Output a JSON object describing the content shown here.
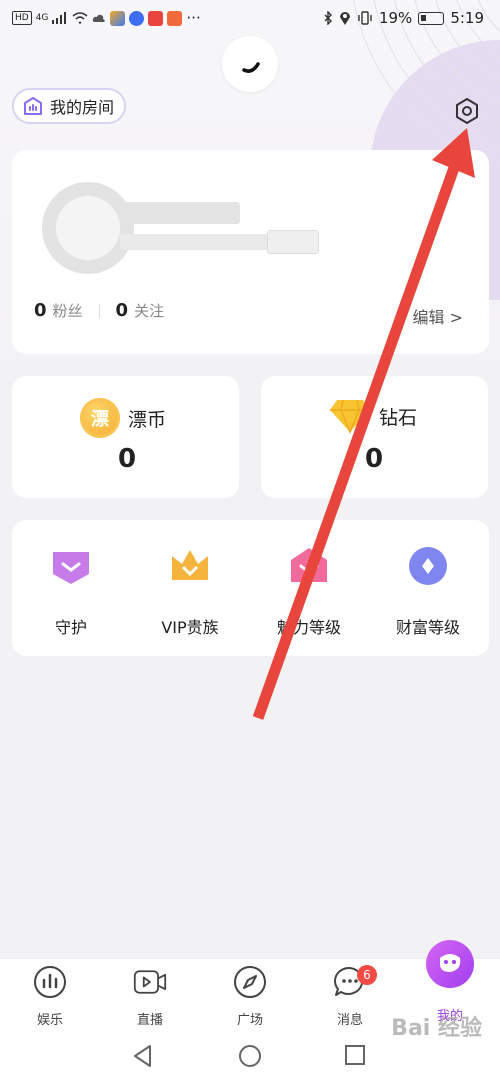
{
  "status_bar": {
    "left_label": "HD",
    "network": "4G",
    "more": "···",
    "battery_percent": "19%",
    "time": "5:19"
  },
  "header": {
    "room_button_label": "我的房间"
  },
  "profile": {
    "fans_count": "0",
    "fans_label": "粉丝",
    "follow_count": "0",
    "follow_label": "关注",
    "edit_label": "编辑 >"
  },
  "wallet": {
    "coin_label": "漂币",
    "coin_icon_char": "漂",
    "coin_value": "0",
    "diamond_label": "钻石",
    "diamond_value": "0"
  },
  "features": [
    {
      "label": "守护",
      "color": "#c77be8"
    },
    {
      "label": "VIP贵族",
      "color": "#f4b43e"
    },
    {
      "label": "魅力等级",
      "color": "#f06b9b"
    },
    {
      "label": "财富等级",
      "color": "#7f86f0"
    }
  ],
  "bottom_nav": {
    "items": [
      {
        "label": "娱乐",
        "icon": "bar-chart-icon"
      },
      {
        "label": "直播",
        "icon": "video-play-icon"
      },
      {
        "label": "广场",
        "icon": "compass-icon"
      },
      {
        "label": "消息",
        "icon": "chat-bubble-icon"
      },
      {
        "label": "我的",
        "icon": "profile-bubble-icon"
      }
    ],
    "message_badge": "6"
  },
  "watermark": "Bai 经验",
  "colors": {
    "accent": "#9b3fe0",
    "arrow": "#e8453c"
  }
}
